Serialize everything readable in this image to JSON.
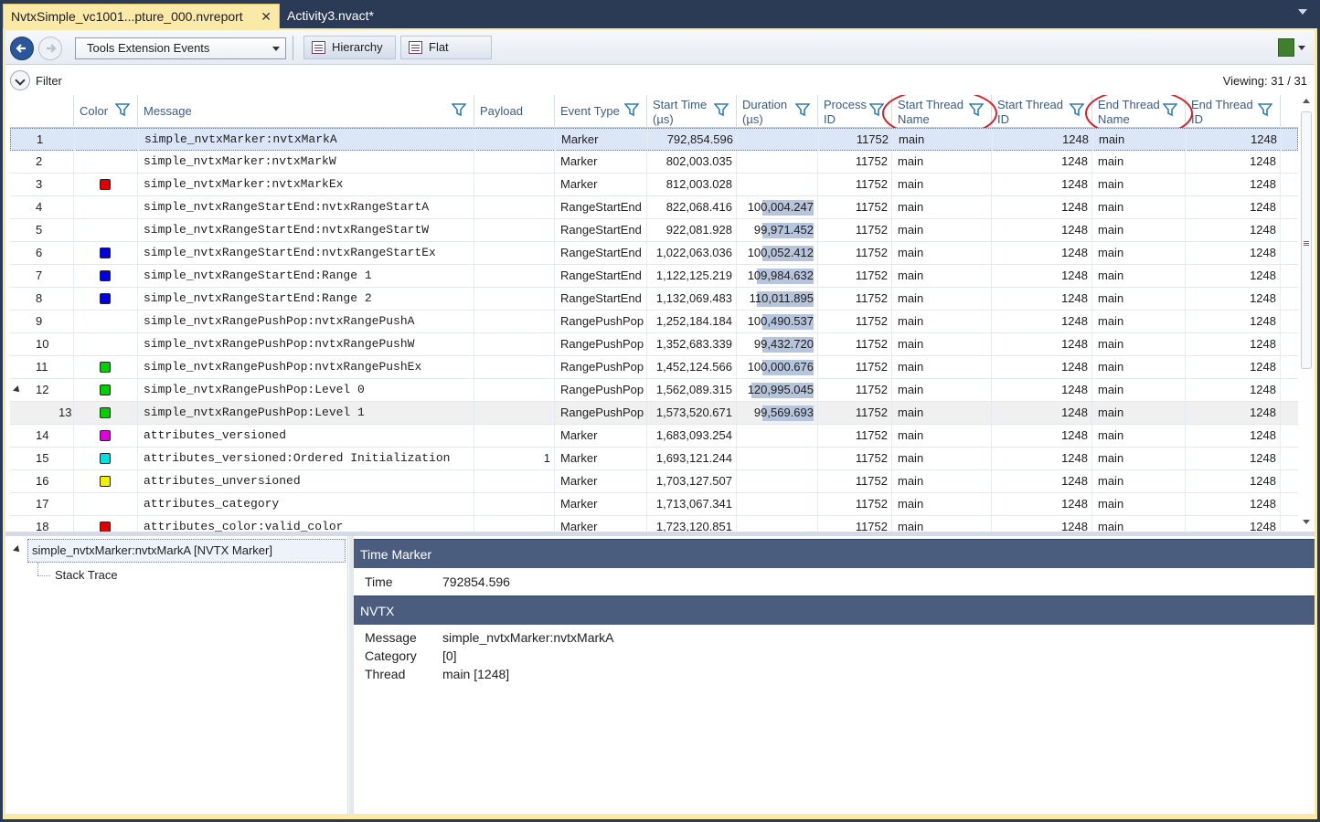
{
  "tabs": [
    {
      "label": "NvtxSimple_vc1001...pture_000.nvreport",
      "close": "✕"
    },
    {
      "label": "Activity3.nvact*"
    }
  ],
  "toolbar": {
    "event_combo": "Tools Extension Events",
    "hierarchy_label": "Hierarchy",
    "flat_label": "Flat"
  },
  "filter": {
    "label": "Filter",
    "viewing": "Viewing: 31 / 31"
  },
  "columns": {
    "color": "Color",
    "message": "Message",
    "payload": "Payload",
    "event_type": "Event Type",
    "start_time_1": "Start Time",
    "start_time_2": "(µs)",
    "duration_1": "Duration",
    "duration_2": "(µs)",
    "process_1": "Process",
    "process_2": "ID",
    "st_name_1": "Start Thread",
    "st_name_2": "Name",
    "st_id_1": "Start Thread",
    "st_id_2": "ID",
    "et_name_1": "End Thread",
    "et_name_2": "Name",
    "et_id_1": "End Thread",
    "et_id_2": "ID"
  },
  "accent_colors": {
    "annotation_circle": "#d9222a",
    "header_text": "#3b5b86",
    "section_header": "#4b5d7f"
  },
  "rows": [
    {
      "num": "1",
      "color": "",
      "message": "simple_nvtxMarker:nvtxMarkA",
      "payload": "",
      "type": "Marker",
      "start": "792,854.596",
      "duration": "",
      "dur_frac": 0,
      "pid": "11752",
      "st_name": "main",
      "st_id": "1248",
      "et_name": "main",
      "et_id": "1248",
      "selected": true
    },
    {
      "num": "2",
      "color": "",
      "message": "simple_nvtxMarker:nvtxMarkW",
      "payload": "",
      "type": "Marker",
      "start": "802,003.035",
      "duration": "",
      "dur_frac": 0,
      "pid": "11752",
      "st_name": "main",
      "st_id": "1248",
      "et_name": "main",
      "et_id": "1248"
    },
    {
      "num": "3",
      "color": "#e00000",
      "message": "simple_nvtxMarker:nvtxMarkEx",
      "payload": "",
      "type": "Marker",
      "start": "812,003.028",
      "duration": "",
      "dur_frac": 0,
      "pid": "11752",
      "st_name": "main",
      "st_id": "1248",
      "et_name": "main",
      "et_id": "1248"
    },
    {
      "num": "4",
      "color": "",
      "message": "simple_nvtxRangeStartEnd:nvtxRangeStartA",
      "payload": "",
      "type": "RangeStartEnd",
      "start": "822,068.416",
      "duration": "100,004.247",
      "dur_frac": 0.83,
      "pid": "11752",
      "st_name": "main",
      "st_id": "1248",
      "et_name": "main",
      "et_id": "1248"
    },
    {
      "num": "5",
      "color": "",
      "message": "simple_nvtxRangeStartEnd:nvtxRangeStartW",
      "payload": "",
      "type": "RangeStartEnd",
      "start": "922,081.928",
      "duration": "99,971.452",
      "dur_frac": 0.83,
      "pid": "11752",
      "st_name": "main",
      "st_id": "1248",
      "et_name": "main",
      "et_id": "1248"
    },
    {
      "num": "6",
      "color": "#0000e0",
      "message": "simple_nvtxRangeStartEnd:nvtxRangeStartEx",
      "payload": "",
      "type": "RangeStartEnd",
      "start": "1,022,063.036",
      "duration": "100,052.412",
      "dur_frac": 0.83,
      "pid": "11752",
      "st_name": "main",
      "st_id": "1248",
      "et_name": "main",
      "et_id": "1248"
    },
    {
      "num": "7",
      "color": "#0000e0",
      "message": "simple_nvtxRangeStartEnd:Range 1",
      "payload": "",
      "type": "RangeStartEnd",
      "start": "1,122,125.219",
      "duration": "109,984.632",
      "dur_frac": 0.91,
      "pid": "11752",
      "st_name": "main",
      "st_id": "1248",
      "et_name": "main",
      "et_id": "1248"
    },
    {
      "num": "8",
      "color": "#0000e0",
      "message": "simple_nvtxRangeStartEnd:Range 2",
      "payload": "",
      "type": "RangeStartEnd",
      "start": "1,132,069.483",
      "duration": "110,011.895",
      "dur_frac": 0.91,
      "pid": "11752",
      "st_name": "main",
      "st_id": "1248",
      "et_name": "main",
      "et_id": "1248"
    },
    {
      "num": "9",
      "color": "",
      "message": "simple_nvtxRangePushPop:nvtxRangePushA",
      "payload": "",
      "type": "RangePushPop",
      "start": "1,252,184.184",
      "duration": "100,490.537",
      "dur_frac": 0.83,
      "pid": "11752",
      "st_name": "main",
      "st_id": "1248",
      "et_name": "main",
      "et_id": "1248"
    },
    {
      "num": "10",
      "color": "",
      "message": "simple_nvtxRangePushPop:nvtxRangePushW",
      "payload": "",
      "type": "RangePushPop",
      "start": "1,352,683.339",
      "duration": "99,432.720",
      "dur_frac": 0.82,
      "pid": "11752",
      "st_name": "main",
      "st_id": "1248",
      "et_name": "main",
      "et_id": "1248"
    },
    {
      "num": "11",
      "color": "#00d000",
      "message": "simple_nvtxRangePushPop:nvtxRangePushEx",
      "payload": "",
      "type": "RangePushPop",
      "start": "1,452,124.566",
      "duration": "100,000.676",
      "dur_frac": 0.83,
      "pid": "11752",
      "st_name": "main",
      "st_id": "1248",
      "et_name": "main",
      "et_id": "1248"
    },
    {
      "num": "12",
      "color": "#00d000",
      "message": "simple_nvtxRangePushPop:Level 0",
      "payload": "",
      "type": "RangePushPop",
      "start": "1,562,089.315",
      "duration": "120,995.045",
      "dur_frac": 1.0,
      "pid": "11752",
      "st_name": "main",
      "st_id": "1248",
      "et_name": "main",
      "et_id": "1248",
      "expander": true
    },
    {
      "num": "13",
      "color": "#00d000",
      "message": "simple_nvtxRangePushPop:Level 1",
      "payload": "",
      "type": "RangePushPop",
      "start": "1,573,520.671",
      "duration": "99,569.693",
      "dur_frac": 0.82,
      "pid": "11752",
      "st_name": "main",
      "st_id": "1248",
      "et_name": "main",
      "et_id": "1248",
      "child": true
    },
    {
      "num": "14",
      "color": "#e000e0",
      "message": "attributes_versioned",
      "payload": "",
      "type": "Marker",
      "start": "1,683,093.254",
      "duration": "",
      "dur_frac": 0,
      "pid": "11752",
      "st_name": "main",
      "st_id": "1248",
      "et_name": "main",
      "et_id": "1248"
    },
    {
      "num": "15",
      "color": "#00e0e0",
      "message": "attributes_versioned:Ordered Initialization",
      "payload": "1",
      "type": "Marker",
      "start": "1,693,121.244",
      "duration": "",
      "dur_frac": 0,
      "pid": "11752",
      "st_name": "main",
      "st_id": "1248",
      "et_name": "main",
      "et_id": "1248"
    },
    {
      "num": "16",
      "color": "#f0f000",
      "message": "attributes_unversioned",
      "payload": "",
      "type": "Marker",
      "start": "1,703,127.507",
      "duration": "",
      "dur_frac": 0,
      "pid": "11752",
      "st_name": "main",
      "st_id": "1248",
      "et_name": "main",
      "et_id": "1248"
    },
    {
      "num": "17",
      "color": "",
      "message": "attributes_category",
      "payload": "",
      "type": "Marker",
      "start": "1,713,067.341",
      "duration": "",
      "dur_frac": 0,
      "pid": "11752",
      "st_name": "main",
      "st_id": "1248",
      "et_name": "main",
      "et_id": "1248"
    },
    {
      "num": "18",
      "color": "#e00000",
      "message": "attributes_color:valid_color",
      "payload": "",
      "type": "Marker",
      "start": "1,723,120.851",
      "duration": "",
      "dur_frac": 0,
      "pid": "11752",
      "st_name": "main",
      "st_id": "1248",
      "et_name": "main",
      "et_id": "1248"
    }
  ],
  "tree": {
    "root": "simple_nvtxMarker:nvtxMarkA [NVTX Marker]",
    "child": "Stack Trace"
  },
  "details": {
    "time_header": "Time Marker",
    "time_key": "Time",
    "time_val": "792854.596",
    "nvtx_header": "NVTX",
    "message_key": "Message",
    "message_val": "simple_nvtxMarker:nvtxMarkA",
    "category_key": "Category",
    "category_val": "[0]",
    "thread_key": "Thread",
    "thread_val": "main [1248]"
  }
}
